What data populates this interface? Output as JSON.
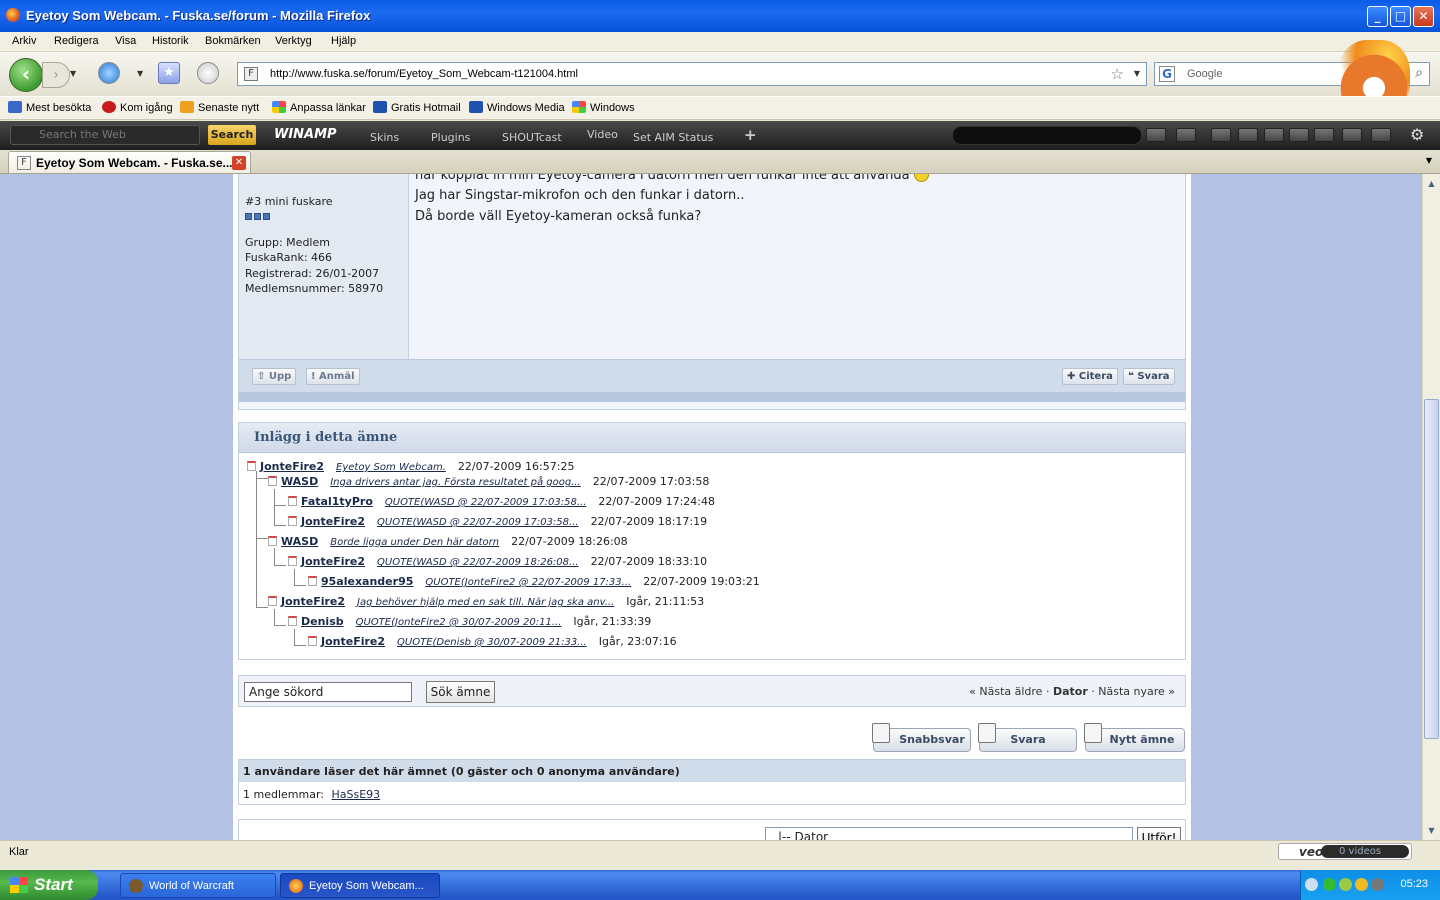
{
  "window": {
    "title": "Eyetoy Som Webcam. - Fuska.se/forum - Mozilla Firefox"
  },
  "menu": [
    "Arkiv",
    "Redigera",
    "Visa",
    "Historik",
    "Bokmärken",
    "Verktyg",
    "Hjälp"
  ],
  "nav": {
    "url": "http://www.fuska.se/forum/Eyetoy_Som_Webcam-t121004.html",
    "search_placeholder": "Google"
  },
  "bookmarks": [
    "Mest besökta",
    "Kom igång",
    "Senaste nytt",
    "Anpassa länkar",
    "Gratis Hotmail",
    "Windows Media",
    "Windows"
  ],
  "winamp": {
    "search_placeholder": "Search the Web",
    "search_button": "Search",
    "logo": "WINAMP",
    "menus": [
      "Skins",
      "Plugins",
      "SHOUTcast",
      "Video",
      "Set AIM Status"
    ],
    "add": "+"
  },
  "tab": {
    "title": "Eyetoy Som Webcam. - Fuska.se..."
  },
  "post": {
    "rank": "#3 mini fuskare",
    "group": "Grupp: Medlem",
    "fuskarank": "FuskaRank: 466",
    "registered": "Registrerad: 26/01-2007",
    "member_no": "Medlemsnummer: 58970",
    "lines": [
      "har kopplat in min Eyetoy-camera i datorn men den funkar inte att använda",
      "Jag har Singstar-mikrofon och den funkar i datorn..",
      "Då borde väll Eyetoy-kameran också funka?"
    ],
    "buttons": {
      "up": "Upp",
      "report": "Anmäl",
      "quote": "Citera",
      "reply": "Svara"
    }
  },
  "thread": {
    "heading": "Inlägg i detta ämne",
    "rows": [
      {
        "author": "JonteFire2",
        "title": "Eyetoy Som Webcam.",
        "date": "22/07-2009 16:57:25"
      },
      {
        "author": "WASD",
        "title": "Inga drivers antar jag. Första resultatet på goog...",
        "date": "22/07-2009 17:03:58"
      },
      {
        "author": "Fatal1tyPro",
        "title": "QUOTE(WASD @ 22/07-2009 17:03:58...",
        "date": "22/07-2009 17:24:48"
      },
      {
        "author": "JonteFire2",
        "title": "QUOTE(WASD @ 22/07-2009 17:03:58...",
        "date": "22/07-2009 18:17:19"
      },
      {
        "author": "WASD",
        "title": "Borde ligga under Den här datorn",
        "date": "22/07-2009 18:26:08"
      },
      {
        "author": "JonteFire2",
        "title": "QUOTE(WASD @ 22/07-2009 18:26:08...",
        "date": "22/07-2009 18:33:10"
      },
      {
        "author": "95alexander95",
        "title": "QUOTE(JonteFire2 @ 22/07-2009 17:33...",
        "date": "22/07-2009 19:03:21"
      },
      {
        "author": "JonteFire2",
        "title": "Jag behöver hjälp med en sak till. När jag ska anv...",
        "date": "Igår, 21:11:53"
      },
      {
        "author": "Denisb",
        "title": "QUOTE(JonteFire2 @ 30/07-2009 20:11...",
        "date": "Igår, 21:33:39"
      },
      {
        "author": "JonteFire2",
        "title": "QUOTE(Denisb @ 30/07-2009 21:33...",
        "date": "Igår, 23:07:16"
      }
    ]
  },
  "search": {
    "value": "Ange sökord",
    "button": "Sök ämne",
    "older": "« Nästa äldre",
    "sep": "·",
    "forum": "Dator",
    "newer": "Nästa nyare »"
  },
  "actions": {
    "quick": "Snabbsvar",
    "reply": "Svara",
    "new": "Nytt ämne"
  },
  "readers": {
    "header": "1 användare läser det här ämnet (0 gäster och 0 anonyma användare)",
    "members_label": "1 medlemmar:",
    "member": "HaSsE93"
  },
  "jump": {
    "select": "|-- Dator",
    "button": "Utför!"
  },
  "status": {
    "text": "Klar",
    "veoh": "veoh",
    "videos": "0 videos"
  },
  "taskbar": {
    "start": "Start",
    "items": [
      "World of Warcraft",
      "Eyetoy Som Webcam..."
    ],
    "clock": "05:23"
  }
}
